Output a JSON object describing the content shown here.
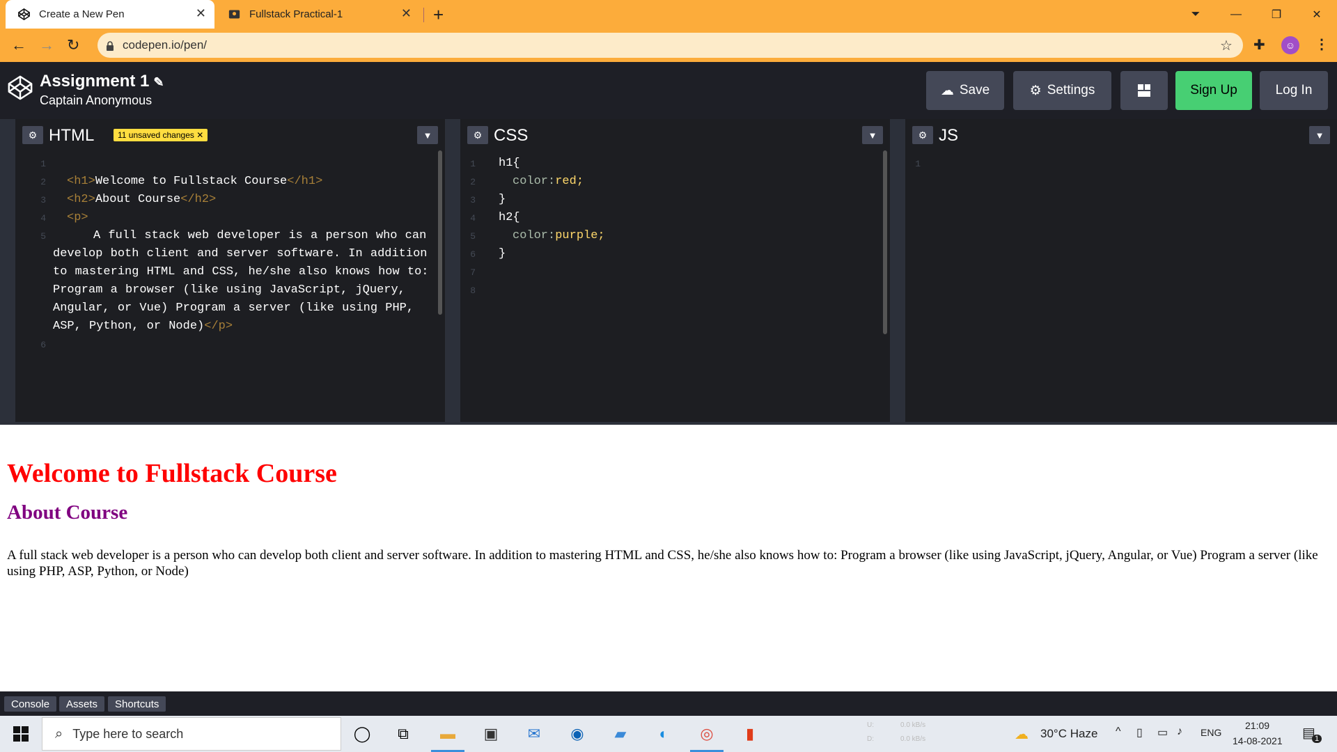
{
  "browser": {
    "tabs": [
      {
        "title": "Create a New Pen",
        "active": true
      },
      {
        "title": "Fullstack Practical-1",
        "active": false
      }
    ],
    "url": "codepen.io/pen/"
  },
  "codepen": {
    "title": "Assignment 1",
    "author": "Captain Anonymous",
    "buttons": {
      "save": "Save",
      "settings": "Settings",
      "signup": "Sign Up",
      "login": "Log In"
    }
  },
  "editors": {
    "html": {
      "title": "HTML",
      "badge": "11 unsaved changes",
      "line_numbers": [
        "1",
        "2",
        "3",
        "4",
        "5",
        "6"
      ]
    },
    "css": {
      "title": "CSS",
      "line_numbers": [
        "1",
        "2",
        "3",
        "4",
        "5",
        "6",
        "7",
        "8"
      ],
      "lines": [
        "h1{",
        "color:",
        "red;",
        "}",
        "h2{",
        "color:",
        "purple;",
        "}"
      ]
    },
    "js": {
      "title": "JS",
      "line_numbers": [
        "1"
      ]
    }
  },
  "preview": {
    "h1": "Welcome to Fullstack Course",
    "h2": "About Course",
    "p": "A full stack web developer is a person who can develop both client and server software. In addition to mastering HTML and CSS, he/she also knows how to: Program a browser (like using JavaScript, jQuery, Angular, or Vue) Program a server (like using PHP, ASP, Python, or Node)"
  },
  "footer": {
    "console": "Console",
    "assets": "Assets",
    "shortcuts": "Shortcuts"
  },
  "taskbar": {
    "search_placeholder": "Type here to search",
    "weather": "30°C  Haze",
    "lang": "ENG",
    "time": "21:09",
    "date": "14-08-2021",
    "notification_count": "1",
    "net_up": "0.0 kB/s",
    "net_down": "0.0 kB/s"
  },
  "colors": {
    "accent": "#fcac3b",
    "signup": "#47cf73",
    "h1": "#ff0000",
    "h2": "#800080"
  }
}
